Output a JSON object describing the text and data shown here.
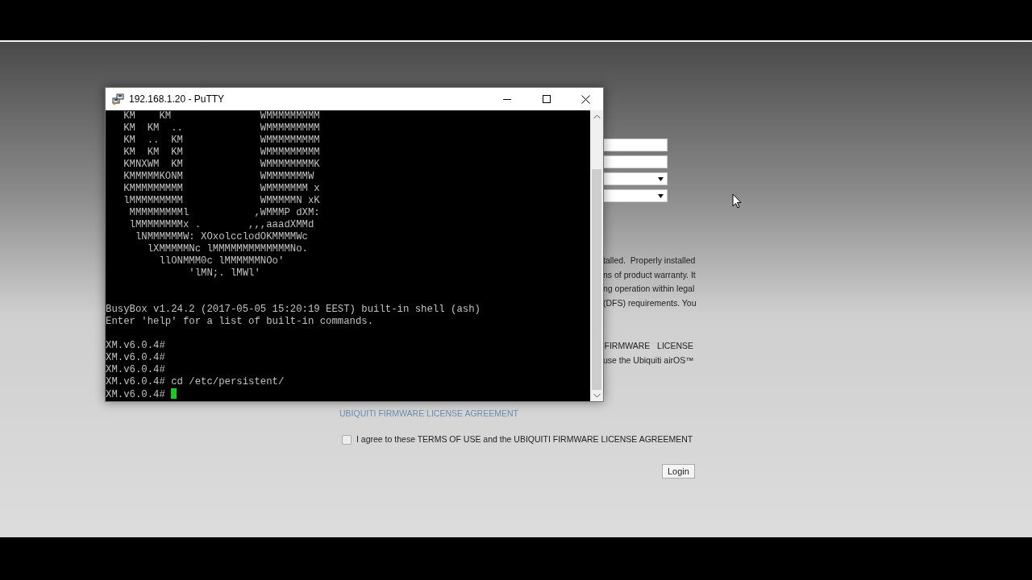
{
  "background_page": {
    "fields": [
      {
        "kind": "text"
      },
      {
        "kind": "text"
      },
      {
        "kind": "select"
      },
      {
        "kind": "select"
      }
    ],
    "notice_paragraphs": [
      [
        "talled.  Properly installed",
        "ns of product warranty. It",
        "ng operation within legal",
        "(DFS) requirements. You"
      ],
      [
        "FIRMWARE   LICENSE",
        "use the Ubiquiti airOS™"
      ]
    ],
    "license_link": "UBIQUITI FIRMWARE LICENSE AGREEMENT",
    "agree": {
      "checked": false,
      "label": "I agree to these TERMS OF USE and the UBIQUITI FIRMWARE LICENSE AGREEMENT"
    },
    "login_button": "Login"
  },
  "putty": {
    "title": "192.168.1.20 - PuTTY",
    "blocks": [
      [
        "   KM    KM               WMMMMMMMMM",
        "   KM  KM  ..             WMMMMMMMMM",
        "   KM  ..  KM             WMMMMMMMMM",
        "   KM  KM  KM             WMMMMMMMMM",
        "   KMNXWM  KM             WMMMMMMMMK",
        "   KMMMMMKONM             WMMMMMMMW",
        "   KMMMMMMMMM             WMMMMMMM x",
        "   lMMMMMMMMM             WMMMMMN xK",
        "    MMMMMMMMMl           ,WMMMP dXM:",
        "    lMMMMMMMMx .        ,,,aaadXMMd",
        "     lNMMMMMMW: XOxolcclodOKMMMMWc",
        "       lXMMMMMNc lMMMMMMMMMMMMMNo.",
        "         llONMMM0c lMMMMMMNOo'",
        "              'lMN;. lMWl'"
      ],
      [
        "BusyBox v1.24.2 (2017-05-05 15:20:19 EEST) built-in shell (ash)",
        "Enter 'help' for a list of built-in commands."
      ],
      [
        "XM.v6.0.4#",
        "XM.v6.0.4#",
        "XM.v6.0.4#",
        "XM.v6.0.4# cd /etc/persistent/",
        "XM.v6.0.4#"
      ]
    ]
  }
}
